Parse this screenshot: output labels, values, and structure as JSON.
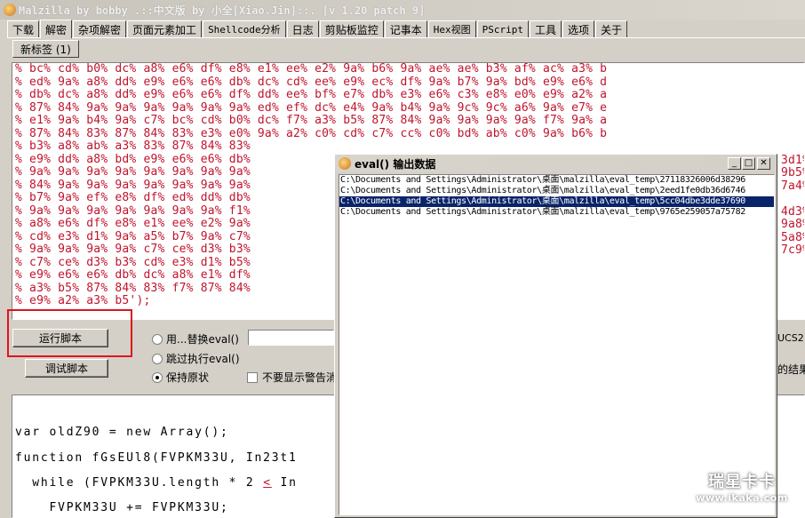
{
  "window": {
    "title": "Malzilla by bobby .::中文版 by 小全[Xiao.Jin]::. [v 1.20 patch 9]"
  },
  "tabs": [
    {
      "label": "下载",
      "mono": false
    },
    {
      "label": "解密",
      "mono": false
    },
    {
      "label": "杂项解密",
      "mono": false
    },
    {
      "label": "页面元素加工",
      "mono": false
    },
    {
      "label": "Shellcode分析",
      "mono": true
    },
    {
      "label": "日志",
      "mono": false
    },
    {
      "label": "剪贴板监控",
      "mono": false
    },
    {
      "label": "记事本",
      "mono": false
    },
    {
      "label": "Hex视图",
      "mono": true
    },
    {
      "label": "PScript",
      "mono": true
    },
    {
      "label": "工具",
      "mono": false
    },
    {
      "label": "选项",
      "mono": false
    },
    {
      "label": "关于",
      "mono": false
    }
  ],
  "active_tab": "解密",
  "subtab": {
    "label": "新标签 (1)"
  },
  "hex_lines": [
    "% bc% cd% b0% dc% a8% e6% df% e8% e1% ee% e2% 9a% b6% 9a% ae% ae% b3% af% ac% a3% b",
    "% ed% 9a% a8% dd% e9% e6% e6% db% dc% cd% ee% e9% ec% df% 9a% b7% 9a% bd% e9% e6% d",
    "% db% dc% a8% dd% e9% e6% e6% df% dd% ee% bf% e7% db% e3% e6% c3% e8% e0% e9% a2% a",
    "% 87% 84% 9a% 9a% 9a% 9a% 9a% 9a% ed% ef% dc% e4% 9a% b4% 9a% 9c% 9c% a6% 9a% e7% e",
    "% e1% 9a% b4% 9a% c7% bc% cd% b0% dc% f7% a3% b5% 87% 84% 9a% 9a% 9a% 9a% f7% 9a% a",
    "% 87% 84% 83% 87% 84% 83% e3% e0% 9a% a2% c0% cd% c7% cc% c0% bd% ab% c0% 9a% b6% b",
    "% b3% a8% ab% a3% 83% 87% 84% 83%",
    "% e9% dd% a8% bd% e9% e6% e6% db%",
    "% 9a% 9a% 9a% 9a% 9a% 9a% 9a% 9a%",
    "% 84% 9a% 9a% 9a% 9a% 9a% 9a% 9a%",
    "% b7% 9a% ef% e8% df% ed% dd% db%",
    "% 9a% 9a% 9a% 9a% 9a% 9a% 9a% f1%",
    "% a8% e6% df% e8% e1% ee% e2% 9a%",
    "% cd% e3% d1% 9a% a5% b7% 9a% c7%",
    "% 9a% 9a% 9a% 9a% c7% ce% d3% b3%",
    "% c7% ce% d3% b3% cd% e3% d1% b5%",
    "% e9% e6% e6% db% dc% a8% e1% df%",
    "% a3% b5% 87% 84% 83% f7% 87% 84%",
    "% e9% a2% a3% b5');"
  ],
  "hex_right_fragments": [
    {
      "line": 7,
      "text": "3d1%"
    },
    {
      "line": 8,
      "text": "9b5%"
    },
    {
      "line": 9,
      "text": "7a4%"
    },
    {
      "line": 11,
      "text": "4d3%"
    },
    {
      "line": 12,
      "text": "9a8%"
    },
    {
      "line": 13,
      "text": "5a8%"
    },
    {
      "line": 14,
      "text": "7c9%"
    }
  ],
  "buttons": {
    "run_script": "运行脚本",
    "debug_script": "调试脚本"
  },
  "options": {
    "replace_eval_label": "用...替换eval()",
    "skip_eval_label": "跳过执行eval()",
    "keep_original_label": "保持原状",
    "no_warning_label": "不要显示警告消"
  },
  "right_labels": {
    "ucs2": "UCS2",
    "result": "的结果"
  },
  "code_lines": [
    {
      "pre": "",
      "und": "",
      "post": ""
    },
    {
      "pre": "var oldZ90 = new Array();",
      "und": "",
      "post": ""
    },
    {
      "pre": "function fGsEUl8(FVPKM33U, In23t1",
      "und": "",
      "post": ""
    },
    {
      "pre": "  while (FVPKM33U.length * 2 ",
      "und": "<",
      "post": " In"
    },
    {
      "pre": "    FVPKM33U += FVPKM33U;",
      "und": "",
      "post": ""
    }
  ],
  "popup": {
    "title": "eval() 输出数据",
    "items": [
      {
        "text": "C:\\Documents and Settings\\Administrator\\桌面\\malzilla\\eval_temp\\27118326006d38296",
        "selected": false
      },
      {
        "text": "C:\\Documents and Settings\\Administrator\\桌面\\malzilla\\eval_temp\\2eed1fe0db36d6746",
        "selected": false
      },
      {
        "text": "C:\\Documents and Settings\\Administrator\\桌面\\malzilla\\eval_temp\\5cc04dbe3dde37690",
        "selected": true
      },
      {
        "text": "C:\\Documents and Settings\\Administrator\\桌面\\malzilla\\eval_temp\\9765e259057a75782",
        "selected": false
      }
    ]
  },
  "watermark": {
    "line1": "瑞星卡卡",
    "line2": "www.ikaka.com"
  },
  "colors": {
    "hex_text": "#c0142c",
    "highlight_box": "#e0141c",
    "selection": "#0a246a"
  }
}
